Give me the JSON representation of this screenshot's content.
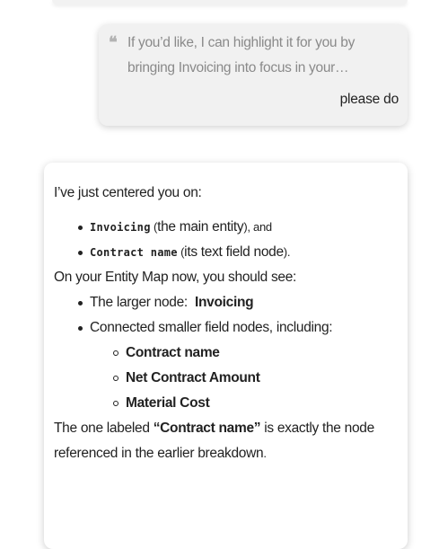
{
  "user_message": {
    "quote_icon": "quote-icon",
    "quoted_text": "If you’d like, I can highlight it for you by bringing Invoicing into focus in your…",
    "reply": "please do"
  },
  "assistant_message": {
    "intro": "I’ve just centered you on:",
    "centered_items": [
      {
        "code": "Invoicing",
        "note_open": " (",
        "note": "the main entity",
        "note_close": "), and"
      },
      {
        "code": "Contract name",
        "note_open": " (",
        "note": "its text field node",
        "note_close": ")."
      }
    ],
    "map_intro": "On your Entity Map now, you should see:",
    "map_items": {
      "larger_node_label": "The larger node:",
      "larger_node_name": "Invoicing",
      "connected_label": "Connected smaller field nodes, including:",
      "field_nodes": [
        "Contract name",
        "Net Contract Amount",
        "Material Cost"
      ]
    },
    "closing": {
      "before": "The one labeled ",
      "highlight": "“Contract name”",
      "after": " is exactly the node referenced in the earlier breakdown",
      "end": "."
    }
  }
}
